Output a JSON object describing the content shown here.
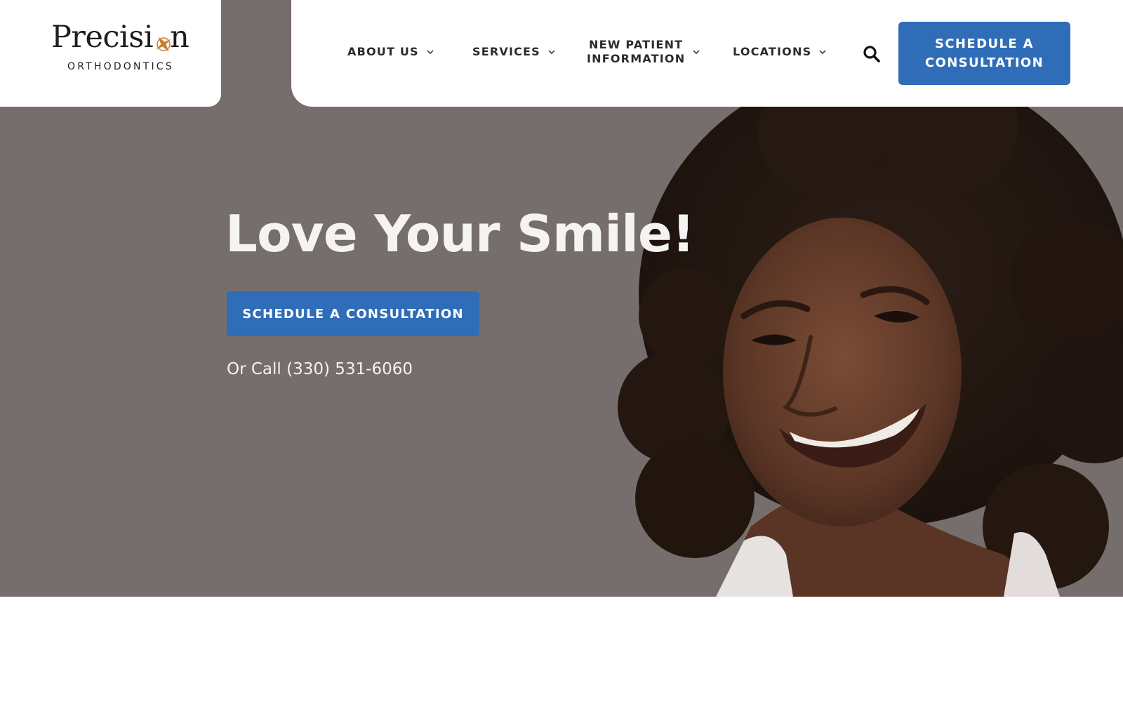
{
  "brand": {
    "name": "Precision",
    "name_left": "Precisi",
    "name_right": "n",
    "tagline": "ORTHODONTICS",
    "accent_color": "#c9802b"
  },
  "nav": {
    "items": [
      {
        "label": "ABOUT US",
        "icon": "chevron-down-icon"
      },
      {
        "label": "SERVICES",
        "icon": "chevron-down-icon"
      },
      {
        "label": "NEW PATIENT INFORMATION",
        "line1": "NEW PATIENT",
        "line2": "INFORMATION",
        "icon": "chevron-down-icon"
      },
      {
        "label": "LOCATIONS",
        "icon": "chevron-down-icon"
      }
    ],
    "search_icon": "search-icon",
    "cta": {
      "line1": "SCHEDULE A",
      "line2": "CONSULTATION"
    }
  },
  "hero": {
    "headline": "Love Your Smile!",
    "cta_label": "SCHEDULE A CONSULTATION",
    "phone_text": "Or Call (330) 531-6060",
    "background_color": "#766e6c"
  },
  "colors": {
    "primary_button": "#2f6db8",
    "nav_text": "#2b2b2b",
    "hero_text": "#f6f4f3"
  }
}
